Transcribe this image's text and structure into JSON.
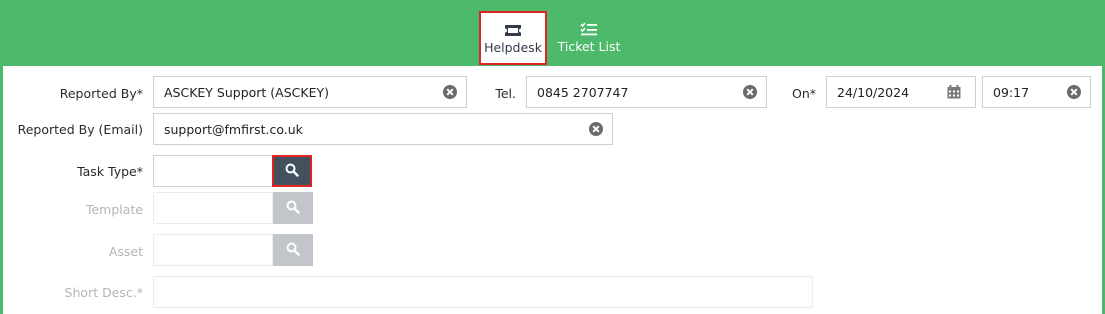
{
  "tabs": [
    {
      "label": "Helpdesk",
      "icon": "ticket-icon",
      "active": true
    },
    {
      "label": "Ticket List",
      "icon": "checklist-icon",
      "active": false
    }
  ],
  "form": {
    "reported_by": {
      "label": "Reported By*",
      "value": "ASCKEY Support (ASCKEY)"
    },
    "tel": {
      "label": "Tel.",
      "value": "0845 2707747"
    },
    "on": {
      "label": "On*",
      "date": "24/10/2024",
      "time": "09:17"
    },
    "reported_by_email": {
      "label": "Reported By (Email)",
      "value": "support@fmfirst.co.uk"
    },
    "task_type": {
      "label": "Task Type*",
      "value": ""
    },
    "template": {
      "label": "Template",
      "value": ""
    },
    "asset": {
      "label": "Asset",
      "value": ""
    },
    "short_desc": {
      "label": "Short Desc.*",
      "value": ""
    }
  },
  "colors": {
    "accent": "#4cb96b",
    "highlight": "#e02424",
    "button_dark": "#43505e",
    "button_disabled": "#c2c5c9"
  }
}
